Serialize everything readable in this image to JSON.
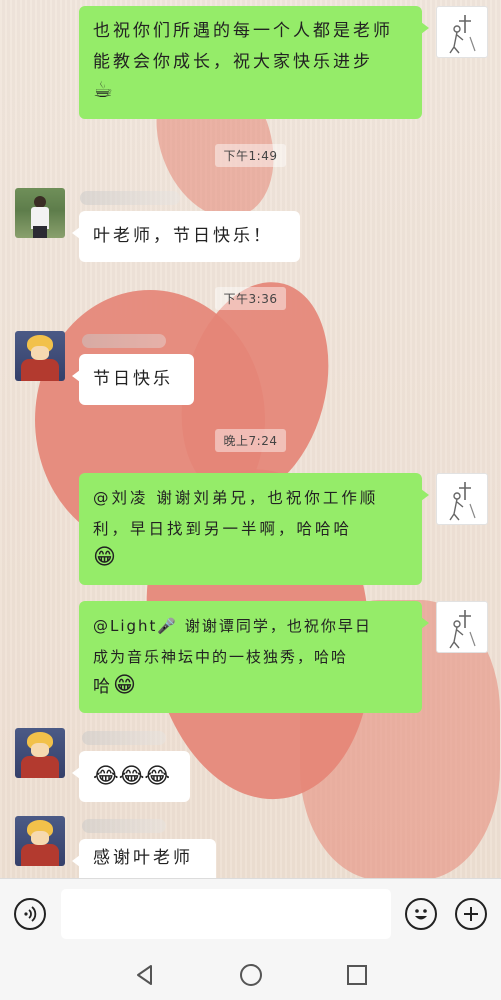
{
  "messages": [
    {
      "side": "right",
      "text_line1": "也祝你们所遇的每一个人都是老师",
      "text_line2": "能教会你成长，祝大家快乐进步",
      "emoji": "☕"
    },
    {
      "time": "下午1:49"
    },
    {
      "side": "left",
      "text": "叶老师，节日快乐！"
    },
    {
      "time": "下午3:36"
    },
    {
      "side": "left",
      "text": "节日快乐"
    },
    {
      "time": "晚上7:24"
    },
    {
      "side": "right",
      "text_line1": "@刘凌 谢谢刘弟兄，也祝你工作顺",
      "text_line2": "利，早日找到另一半啊，哈哈哈",
      "emoji": "😁"
    },
    {
      "side": "right",
      "text_line1": "@Light🎤 谢谢谭同学，也祝你早日",
      "text_line2": "成为音乐神坛中的一枝独秀，哈哈",
      "text_line3": "哈",
      "emoji": "😁"
    },
    {
      "side": "left",
      "emoji": "😂😂😂"
    },
    {
      "side": "left",
      "text": "感谢叶老师"
    }
  ],
  "input": {
    "placeholder": ""
  },
  "icons": {
    "voice": "voice-icon",
    "emoji": "emoji-icon",
    "plus": "plus-icon",
    "back": "back-nav-icon",
    "home": "home-nav-icon",
    "recents": "recents-nav-icon"
  }
}
